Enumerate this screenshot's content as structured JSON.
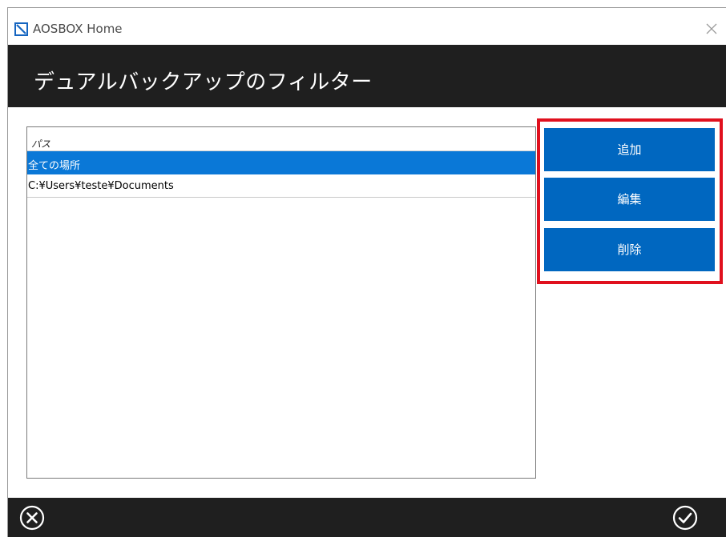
{
  "window": {
    "title": "AOSBOX Home"
  },
  "header": {
    "title": "デュアルバックアップのフィルター"
  },
  "list": {
    "column_header": "パス",
    "rows": [
      {
        "path": "全ての場所",
        "selected": true
      },
      {
        "path": "C:¥Users¥teste¥Documents",
        "selected": false
      }
    ]
  },
  "actions": {
    "add_label": "追加",
    "edit_label": "編集",
    "delete_label": "削除",
    "highlight_color": "#e0101e",
    "button_color": "#0067c0"
  },
  "footer": {
    "cancel_icon": "circle-x-icon",
    "ok_icon": "circle-check-icon"
  },
  "colors": {
    "header_bg": "#1f1f1f",
    "selection": "#0a78d7"
  }
}
